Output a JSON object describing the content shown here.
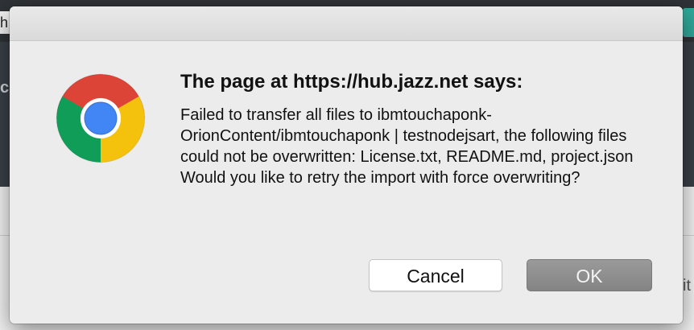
{
  "background": {
    "search_fragment": "h",
    "band_letter": "c",
    "right_fragment": "it"
  },
  "dialog": {
    "icon": "chrome-logo-icon",
    "title": "The page at https://hub.jazz.net says:",
    "message_lines": [
      "Failed to transfer all files to ibmtouchaponk-OrionContent/ibmtouchaponk | testnodejsart, the following files could not be overwritten: License.txt, README.md, project.json",
      "Would you like to retry the import with force overwriting?"
    ],
    "cancel_label": "Cancel",
    "ok_label": "OK"
  },
  "colors": {
    "chrome_red": "#db4437",
    "chrome_green": "#0f9d58",
    "chrome_yellow": "#f4c20d",
    "chrome_blue": "#4285f4",
    "ok_button": "#8c8c8c"
  }
}
